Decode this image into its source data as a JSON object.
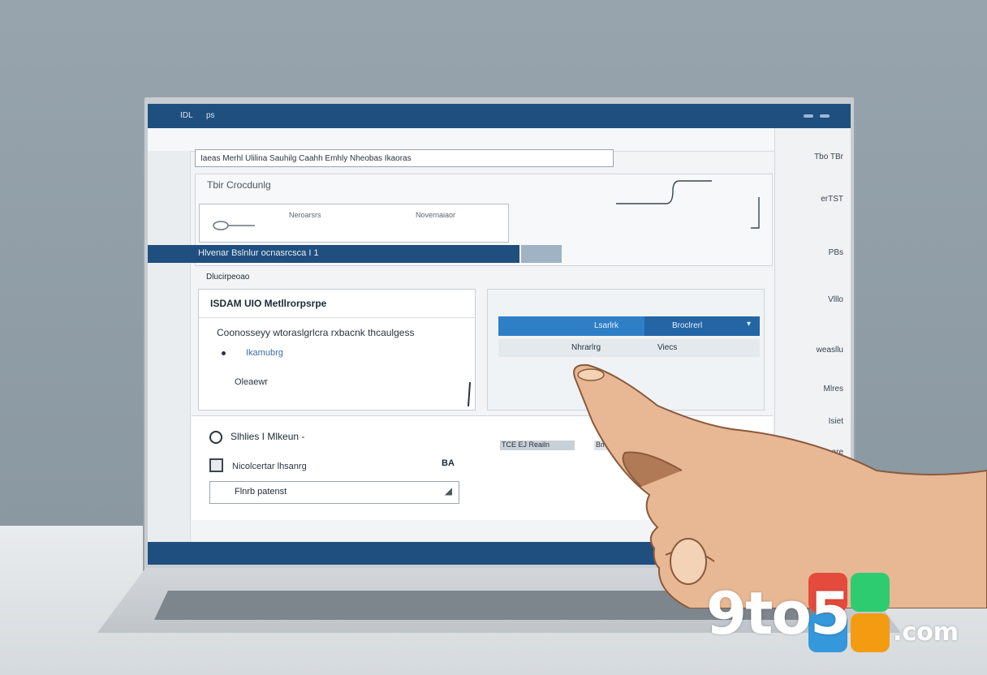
{
  "window": {
    "title_left": "IDL",
    "title_right": "ps"
  },
  "search": {
    "text": "Iaeas Merhl Ulilina Sauhilg  Caahh Emhly Nheobas  Ikaoras"
  },
  "panel": {
    "heading": "Tbir Crocdunlg",
    "label_a": "Neroarsrs",
    "label_b": "Novernaiaor"
  },
  "band": {
    "title": "Hlvenar Bslnlur ocnasrcsca I 1",
    "sub": "Dlucirpeoao"
  },
  "card1": {
    "title": "ISDAM UIO Metllrorpsrpe",
    "body": "Coonosseyy wtoraslgrlcra rxbacnk thcaulgess",
    "option_a": "Ikamubrg",
    "option_b": "Oleaewr"
  },
  "card2": {
    "btn_a": "Lsarlrk",
    "btn_b": "Broclrerl",
    "row_a": "Nhrarlrg",
    "row_b": "Viecs"
  },
  "section3": {
    "heading": "Slhlies I Mlkeun -",
    "checkbox_label": "Nicolcertar lhsanrg",
    "value": "BA",
    "input_value": "Flnrb patenst",
    "tag_a": "TCE EJ Reailn",
    "tag_b": "Bmrdw"
  },
  "rightcol": {
    "items": [
      "Tbo TBr",
      "erTST",
      "PBs",
      "Vlllo",
      "weasllu",
      "Mlres",
      "Isiet",
      "sare"
    ]
  },
  "brand": {
    "text_a": "9to5",
    "text_b": ".com",
    "colors": [
      "#e54b3c",
      "#f39c12",
      "#2ecc71",
      "#3498db"
    ]
  }
}
